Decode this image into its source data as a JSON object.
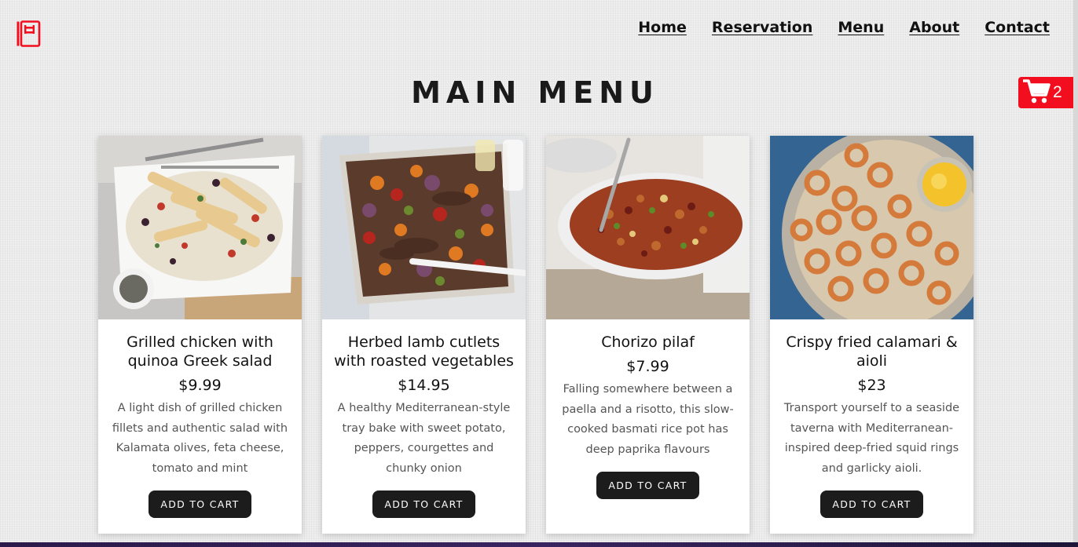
{
  "nav": {
    "logo_icon": "notebook-icon",
    "items": [
      "Home",
      "Reservation",
      "Menu",
      "About",
      "Contact"
    ]
  },
  "page_title": "MAIN MENU",
  "cart": {
    "icon": "shopping-cart-icon",
    "count": "2",
    "color": "#f20e1e"
  },
  "menu_items": [
    {
      "name": "Grilled chicken with quinoa Greek salad",
      "price": "$9.99",
      "description": "A light dish of grilled chicken fillets and authentic salad with Kalamata olives, feta cheese, tomato and mint",
      "button": "ADD TO CART"
    },
    {
      "name": "Herbed lamb cutlets with roasted vegetables",
      "price": "$14.95",
      "description": "A healthy Mediterranean-style tray bake with sweet potato, peppers, courgettes and chunky onion",
      "button": "ADD TO CART"
    },
    {
      "name": "Chorizo pilaf",
      "price": "$7.99",
      "description": "Falling somewhere between a paella and a risotto, this slow-cooked basmati rice pot has deep paprika flavours",
      "button": "ADD TO CART"
    },
    {
      "name": "Crispy fried calamari & aioli",
      "price": "$23",
      "description": "Transport yourself to a seaside taverna with Mediterranean-inspired deep-fried squid rings and garlicky aioli.",
      "button": "ADD TO CART"
    }
  ]
}
